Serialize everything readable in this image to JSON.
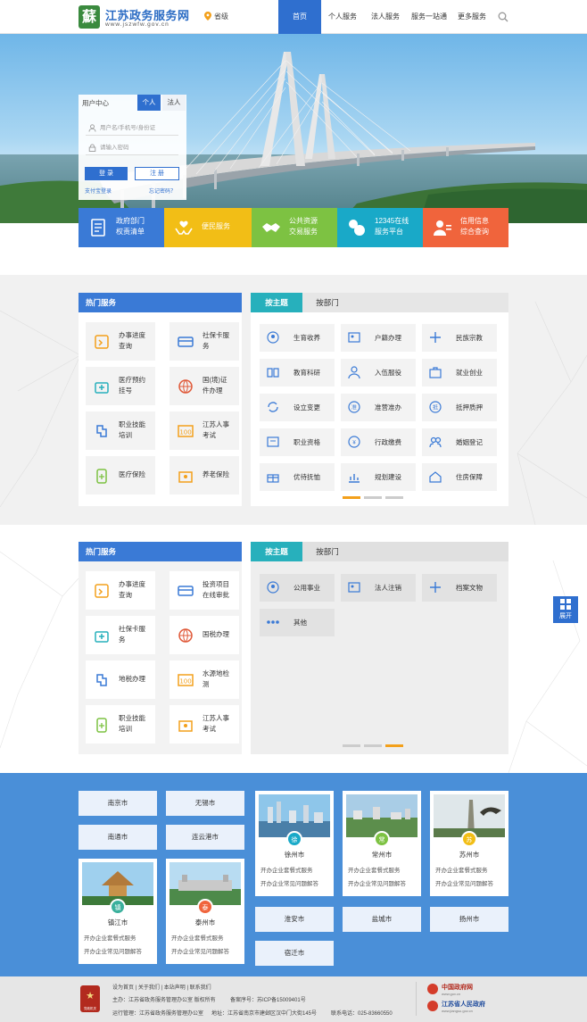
{
  "header": {
    "logo_glyph": "蘇",
    "site_title": "江苏政务服务网",
    "site_domain": "www.jszwfw.gov.cn",
    "location": "省级",
    "nav": {
      "home": "首页",
      "personal": "个人服务",
      "legal": "法人服务",
      "onestop": "服务一站通",
      "more": "更多服务"
    }
  },
  "login": {
    "user_center": "用户中心",
    "tab_person": "个人",
    "tab_legal": "法人",
    "username_placeholder": "用户名/手机号/身份证",
    "password_placeholder": "请输入密码",
    "login_label": "登 录",
    "register_label": "注 册",
    "alipay_label": "支付宝登录",
    "forgot_label": "忘记密码？"
  },
  "quick_tiles": [
    {
      "line1": "政府部门",
      "line2": "权责清单",
      "color": "#3a7ad6"
    },
    {
      "line1": "便民服务",
      "line2": "",
      "color": "#f2be16"
    },
    {
      "line1": "公共资源",
      "line2": "交易服务",
      "color": "#7dc242"
    },
    {
      "line1": "12345在线",
      "line2": "服务平台",
      "color": "#19a9c8"
    },
    {
      "line1": "信用信息",
      "line2": "综合查询",
      "color": "#f0643c"
    }
  ],
  "section1": {
    "hot_title": "热门服务",
    "hot_items": [
      {
        "line1": "办事进度",
        "line2": "查询"
      },
      {
        "line1": "社保卡服",
        "line2": "务"
      },
      {
        "line1": "医疗预约",
        "line2": "挂号"
      },
      {
        "line1": "国(境)证",
        "line2": "件办理"
      },
      {
        "line1": "职业技能",
        "line2": "培训"
      },
      {
        "line1": "江苏人事",
        "line2": "考试"
      },
      {
        "line1": "医疗保险",
        "line2": ""
      },
      {
        "line1": "养老保险",
        "line2": ""
      }
    ],
    "tab_topic": "按主题",
    "tab_dept": "按部门",
    "topics": [
      "生育收养",
      "户籍办理",
      "民族宗教",
      "教育科研",
      "入伍服役",
      "就业创业",
      "设立变更",
      "准营准办",
      "抵押质押",
      "职业资格",
      "行政缴费",
      "婚姻登记",
      "优待抚恤",
      "规划建设",
      "住房保障"
    ]
  },
  "section2": {
    "hot_title": "热门服务",
    "hot_items": [
      {
        "line1": "办事进度",
        "line2": "查询"
      },
      {
        "line1": "投资项目",
        "line2": "在线审批"
      },
      {
        "line1": "社保卡服",
        "line2": "务"
      },
      {
        "line1": "国税办理",
        "line2": ""
      },
      {
        "line1": "地税办理",
        "line2": ""
      },
      {
        "line1": "水源地检",
        "line2": "测"
      },
      {
        "line1": "职业技能",
        "line2": "培训"
      },
      {
        "line1": "江苏人事",
        "line2": "考试"
      }
    ],
    "tab_topic": "按主题",
    "tab_dept": "按部门",
    "topics": [
      "公用事业",
      "法人注销",
      "档案文物",
      "其他"
    ]
  },
  "expand": {
    "label": "展开"
  },
  "cities": {
    "buttons": [
      "南京市",
      "无锡市",
      "南通市",
      "连云港市",
      "淮安市",
      "盐城市",
      "扬州市",
      "宿迁市"
    ],
    "cards": [
      {
        "name": "徐州市",
        "badge": "徐",
        "badge_color": "#19a9c8",
        "line1": "开办企业套餐式服务",
        "line2": "开办企业常见问题解答"
      },
      {
        "name": "常州市",
        "badge": "常",
        "badge_color": "#7dc242",
        "line1": "开办企业套餐式服务",
        "line2": "开办企业常见问题解答"
      },
      {
        "name": "苏州市",
        "badge": "苏",
        "badge_color": "#f2be16",
        "line1": "开办企业套餐式服务",
        "line2": "开办企业常见问题解答"
      },
      {
        "name": "镇江市",
        "badge": "镇",
        "badge_color": "#3ab09c",
        "line1": "开办企业套餐式服务",
        "line2": "开办企业常见问题解答"
      },
      {
        "name": "泰州市",
        "badge": "泰",
        "badge_color": "#f0643c",
        "line1": "开办企业套餐式服务",
        "line2": "开办企业常见问题解答"
      }
    ]
  },
  "footer": {
    "links": "设为首页  |  关于我们  |  本站声明  |  联系我们",
    "host": "主办：江苏省政务服务管理办公室 版权所有",
    "icp": "备案序号：苏ICP备15009401号",
    "operator": "运行管理：江苏省政务服务管理办公室",
    "address": "地址：江苏省南京市建邺区汉中门大街145号",
    "phone": "联系电话：025-83660550",
    "emblem_label": "党政机关",
    "gov1": "中国政府网",
    "gov1_url": "www.gov.cn",
    "gov2": "江苏省人民政府",
    "gov2_url": "www.jiangsu.gov.cn"
  }
}
